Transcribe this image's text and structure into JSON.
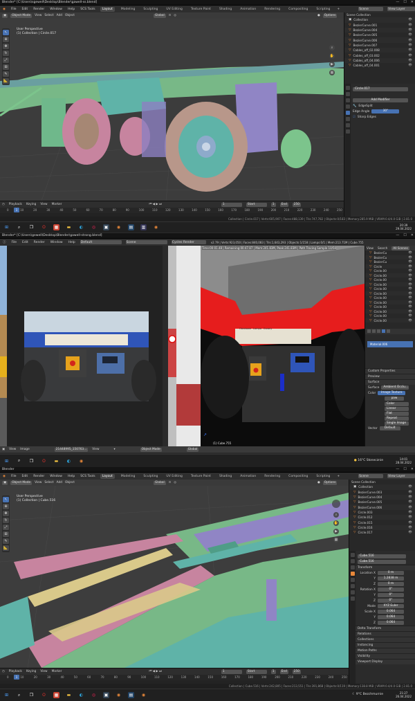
{
  "colors": {
    "accent": "#4772b3",
    "object_orange": "#e8883a",
    "mesh_green": "#78b887",
    "mesh_pink": "#c7849f",
    "mesh_teal": "#5fb3a8",
    "mesh_purple": "#9085c5",
    "vehicle_red": "#e61d1d",
    "plate_blue": "#2f55b8"
  },
  "panel1": {
    "title": "Blender* [C:\\Users\\sgewell\\Desktop\\Blender\\gawell-ss.blend]",
    "menu": [
      "File",
      "Edit",
      "Render",
      "Window",
      "Help",
      "SCS Tools"
    ],
    "workspaces": [
      "Layout",
      "Modeling",
      "Sculpting",
      "UV Editing",
      "Texture Paint",
      "Shading",
      "Animation",
      "Rendering",
      "Compositing",
      "Scripting"
    ],
    "scene": "Scene",
    "view_layer": "View Layer",
    "header": {
      "mode": "Object Mode",
      "menus": [
        "View",
        "Select",
        "Add",
        "Object"
      ],
      "orientation": "Global",
      "options": "Options"
    },
    "viewport": {
      "perspective": "User Perspective",
      "collection": "(1) Collection | Circle.017"
    },
    "outliner": {
      "root": "Scene Collection",
      "collection": "Collection",
      "items": [
        "BezierCurve.001",
        "BezierCurve.004",
        "BezierCurve.005",
        "BezierCurve.006",
        "BezierCurve.007",
        "Cables_off_02.008",
        "Cables_off_03.002",
        "Cables_off_04.006",
        "Cables_off_04.001"
      ]
    },
    "properties": {
      "object": "Circle.017",
      "add_modifier": "Add Modifier",
      "modifier": "EdgeSplit",
      "edge_angle_label": "Edge Angle",
      "edge_angle": "30°",
      "sharp_edges": "Sharp Edges"
    },
    "timeline": {
      "menus": [
        "Playback",
        "Keying",
        "View",
        "Marker"
      ],
      "frame": "1",
      "start_label": "Start",
      "start": "1",
      "end_label": "End",
      "end": "250",
      "ticks": [
        "0",
        "10",
        "20",
        "30",
        "40",
        "50",
        "60",
        "70",
        "80",
        "90",
        "100",
        "110",
        "120",
        "130",
        "140",
        "150",
        "160",
        "170",
        "180",
        "190",
        "200",
        "210",
        "220",
        "230",
        "240",
        "250"
      ]
    },
    "status": "Collection | Circle.017 | Verts:605,907 | Faces:488,139 | Tris:747,782 | Objects:0/183 | Memory:285.9 MiB | VRAM:0.4/4.0 GiB | 2.81.0",
    "clock": {
      "time": "20:39",
      "date": "29.04.2022"
    }
  },
  "panel2": {
    "title": "Blender* [C:\\Users\\gewell\\Desktop\\Blender\\gawell-strong.blend]",
    "menu": [
      "File",
      "Edit",
      "Render",
      "Window",
      "Help"
    ],
    "workspace": "Default",
    "scene": "Scene",
    "engine": "Cycles Render",
    "stats": "v2.79 | Verts:923,050 | Faces:840,083 | Tris:1,643,293 | Objects:1/158 | Lamps:0/1 | Mem:213.71M | Cube.755",
    "render_info": "Time:00:01.48 | Remaining:00:47.87 | Mem:241.83M, Peak:241.83M | Path Tracing Sample 10/50",
    "image_footer": {
      "menus": [
        "View",
        "Image"
      ],
      "image": "21448995_150763...",
      "view": "View"
    },
    "viewport_label": "(1) Cube.755",
    "footer": {
      "mode": "Object Mode",
      "orientation": "Global"
    },
    "plate_labels": [
      "Obrotowe",
      "Lampa",
      "Grzany"
    ],
    "outliner_head": {
      "view": "View",
      "search": "Search",
      "all_scenes": "All Scenes"
    },
    "outliner": [
      "BezierCu",
      "BezierCu",
      "BezierCu",
      "Circle",
      "Circle.00",
      "Circle.00",
      "Circle.00",
      "Circle.00",
      "Circle.00",
      "Circle.00",
      "Circle.00",
      "Circle.00",
      "Circle.00",
      "Circle.00",
      "Circle.00",
      "Circle.00"
    ],
    "properties": {
      "material": "Material.006",
      "sections": [
        "Custom Properties",
        "Preview",
        "Surface"
      ],
      "surface_label": "Surface",
      "surface": "Ambient Occlu...",
      "color_label": "Color",
      "color": "Image Texture",
      "image": "paw",
      "options": [
        "Color",
        "Linear",
        "Flat",
        "Repeat",
        "Single Image"
      ],
      "vector": "Vector",
      "default": "Default"
    },
    "weather": {
      "temp": "16°C",
      "desc": "Słonecznie"
    },
    "clock": {
      "time": "14:01",
      "date": "28.04.2022"
    }
  },
  "panel3": {
    "title": "Blender",
    "menu": [
      "File",
      "Edit",
      "Render",
      "Window",
      "Help",
      "SCS Tools"
    ],
    "workspaces": [
      "Layout",
      "Modeling",
      "Sculpting",
      "UV Editing",
      "Texture Paint",
      "Shading",
      "Animation",
      "Rendering",
      "Compositing",
      "Scripting"
    ],
    "scene": "Scene",
    "view_layer": "View Layer",
    "header": {
      "mode": "Object Mode",
      "menus": [
        "View",
        "Select",
        "Add",
        "Object"
      ],
      "orientation": "Global",
      "options": "Options"
    },
    "viewport": {
      "perspective": "User Perspective",
      "collection": "(1) Collection | Cube.516"
    },
    "outliner": {
      "root": "Scene Collection",
      "collection": "Collection",
      "items": [
        "BezierCurve.003",
        "BezierCurve.004",
        "BezierCurve.005",
        "BezierCurve.006",
        "Circle.003",
        "Circle.012",
        "Circle.015",
        "Circle.016",
        "Circle.017"
      ]
    },
    "properties": {
      "object": "Cube.516",
      "mesh": "Cube.516",
      "transform": "Transform",
      "location_label": "Location X",
      "location": [
        "0 m",
        "1.2838 m",
        "0 m"
      ],
      "rotation_label": "Rotation X",
      "rotation": [
        "0°",
        "0°",
        "0°"
      ],
      "mode_label": "Mode",
      "mode": "XYZ Euler",
      "scale_label": "Scale X",
      "scale": [
        "0.064",
        "0.064",
        "0.064"
      ],
      "axes": [
        "X",
        "Y",
        "Z"
      ],
      "delta": "Delta Transform",
      "sections": [
        "Relations",
        "Collections",
        "Instancing",
        "Motion Paths",
        "Visibility",
        "Viewport Display"
      ]
    },
    "timeline": {
      "menus": [
        "Playback",
        "Keying",
        "View",
        "Marker"
      ],
      "frame": "1",
      "start_label": "Start",
      "start": "1",
      "end_label": "End",
      "end": "250",
      "ticks": [
        "0",
        "10",
        "20",
        "30",
        "40",
        "50",
        "60",
        "70",
        "80",
        "90",
        "100",
        "110",
        "120",
        "130",
        "140",
        "150",
        "160",
        "170",
        "180",
        "190",
        "200",
        "210",
        "220",
        "230",
        "240",
        "250"
      ]
    },
    "status": "Collection | Cube.516 | Verts:242,805 | Faces:213,551 | Tris:391,868 | Objects:0/119 | Memory:138.8 MiB | VRAM:0.4/4.0 GiB | 2.81.0",
    "weather": {
      "temp": "9°C",
      "desc": "Bezchmurnie"
    },
    "clock": {
      "time": "21:27",
      "date": "26.04.2022"
    }
  }
}
